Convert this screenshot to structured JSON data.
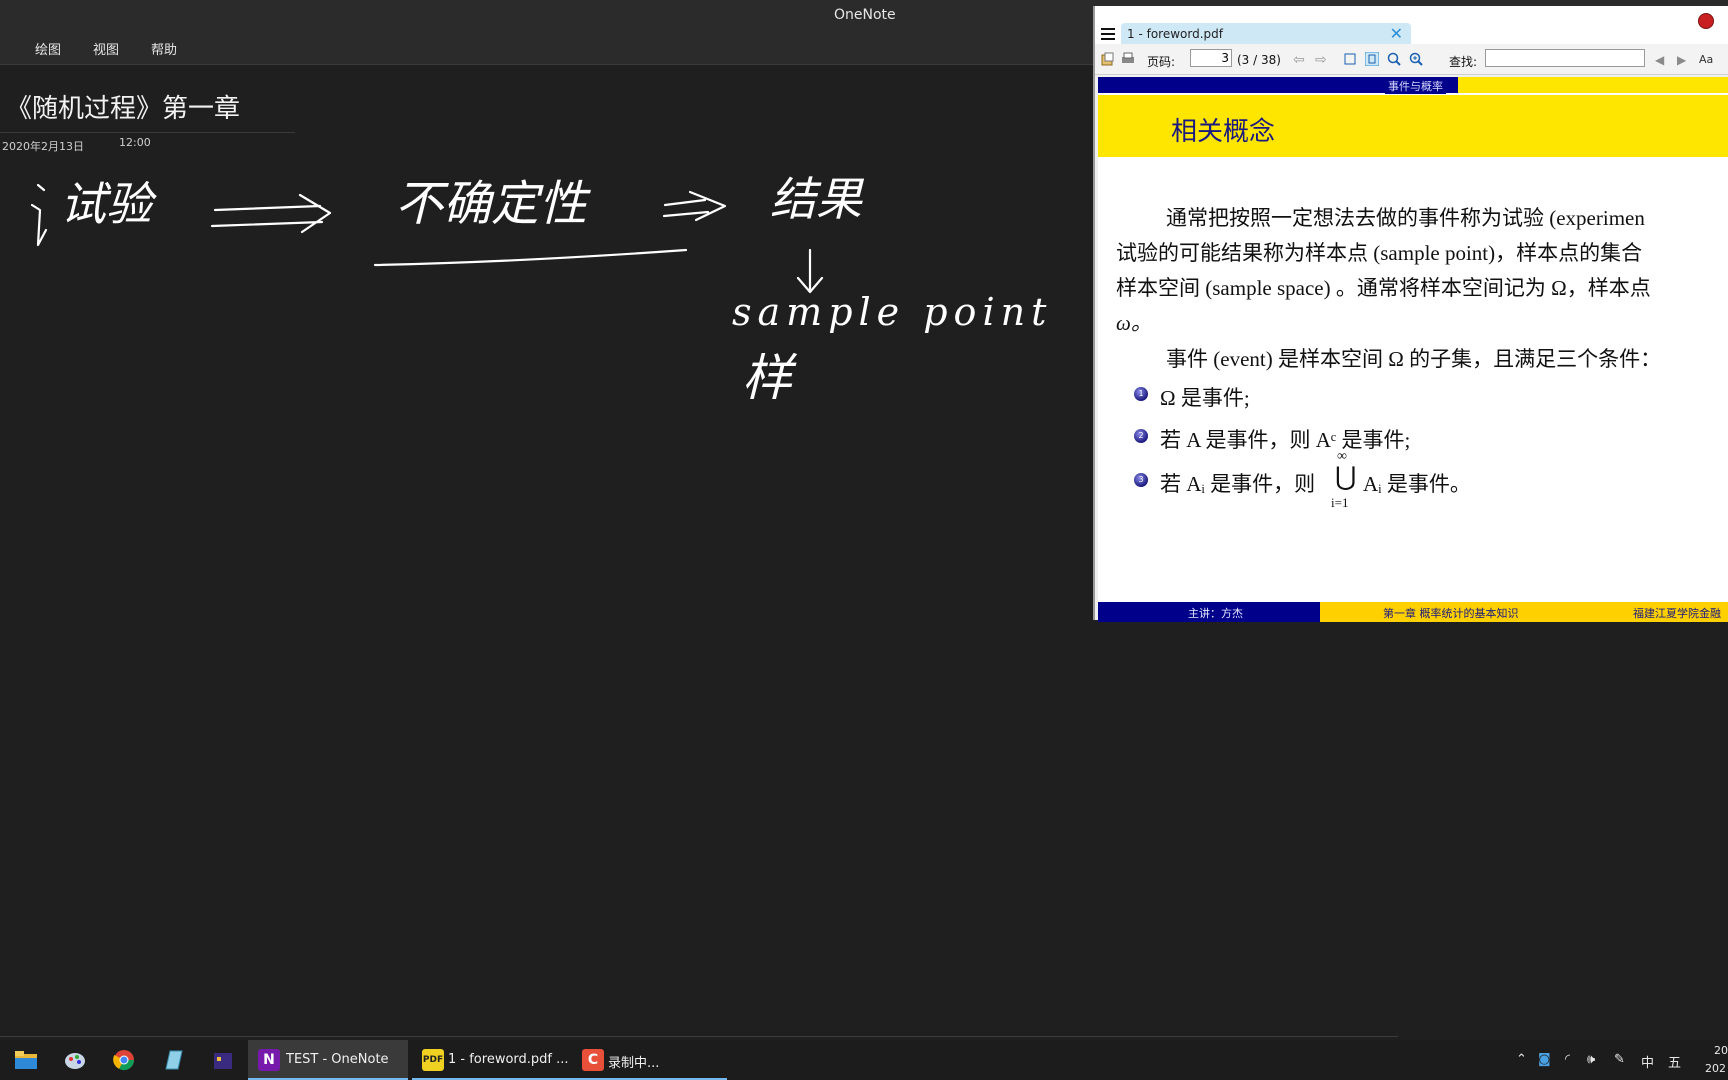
{
  "app": {
    "title": "OneNote"
  },
  "menu": {
    "items": [
      "绘图",
      "视图",
      "帮助"
    ]
  },
  "page": {
    "title": "《随机过程》第一章",
    "date": "2020年2月13日",
    "time": "12:00"
  },
  "ink": {
    "word1": "试验",
    "word2": "不确定性",
    "word3": "结果",
    "word4": "sample point",
    "word5": "样"
  },
  "pdf": {
    "tab_label": "1 - foreword.pdf",
    "toolbar": {
      "page_label": "页码:",
      "page_value": "3",
      "page_total": "(3 / 38)",
      "find_label": "查找:"
    },
    "slide": {
      "section": "事件与概率",
      "title": "相关概念",
      "line1": "通常把按照一定想法去做的事件称为试验 (experimen",
      "line2": "试验的可能结果称为样本点 (sample point)，样本点的集合",
      "line3": "样本空间 (sample space) 。通常将样本空间记为 Ω，样本点",
      "line4": "ω。",
      "line5": "事件 (event) 是样本空间 Ω 的子集，且满足三个条件：",
      "bullet1": "Ω 是事件;",
      "bullet2": "若 A 是事件，则 Aᶜ 是事件;",
      "bullet3_a": "若 Aᵢ 是事件，则",
      "bullet3_union": "⋃",
      "bullet3_sup": "∞",
      "bullet3_sub": "i=1",
      "bullet3_b": "Aᵢ 是事件。",
      "footer_left": "主讲：方杰",
      "footer_mid": "第一章  概率统计的基本知识",
      "footer_right": "福建江夏学院金融"
    }
  },
  "taskbar": {
    "apps": [
      {
        "label": "TEST - OneNote",
        "icon": "onenote-icon"
      },
      {
        "label": "1 - foreword.pdf ...",
        "icon": "pdf-icon"
      },
      {
        "label": "录制中...",
        "icon": "recorder-icon"
      }
    ],
    "tray": {
      "ime": "中",
      "ime2": "五",
      "clock_top": "20",
      "clock_bottom": "202"
    }
  },
  "colors": {
    "slide_blue": "#00008b",
    "slide_yellow": "#ffe600",
    "taskbar_accent": "#76b9ed"
  }
}
